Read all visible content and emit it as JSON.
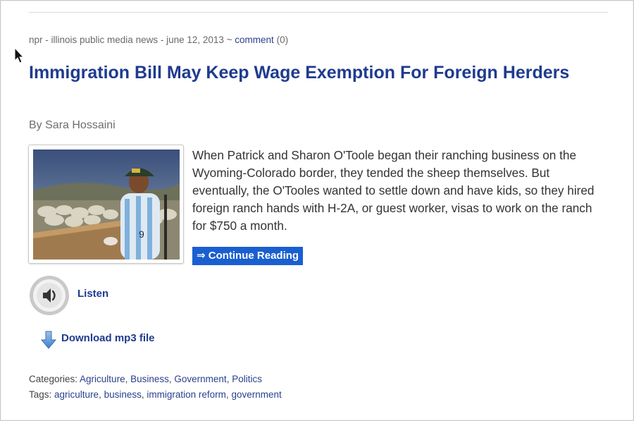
{
  "meta": {
    "source": "npr - illinois public media news - june 12, 2013 ~ ",
    "comment_label": "comment",
    "comment_count": "(0)"
  },
  "article": {
    "title": "Immigration Bill May Keep Wage Exemption For Foreign Herders",
    "byline": "By Sara Hossaini",
    "excerpt": "When Patrick and Sharon O'Toole began their ranching business on the Wyoming-Colorado border, they tended the sheep themselves. But eventually, the O'Tooles wanted to settle down and have kids, so they hired foreign ranch hands with H-2A, or guest worker, visas to work on the ranch for $750 a month.",
    "continue_label": "⇒ Continue Reading"
  },
  "audio": {
    "listen_label": "Listen",
    "download_label": "Download mp3 file"
  },
  "categories": {
    "label": "Categories: ",
    "items": [
      "Agriculture",
      "Business",
      "Government",
      "Politics"
    ]
  },
  "tags": {
    "label": "Tags: ",
    "items": [
      "agriculture",
      "business",
      "immigration reform",
      "government"
    ]
  },
  "colors": {
    "link": "#1f3b8f",
    "button_bg": "#1a5fd0"
  },
  "icons": {
    "speaker": "speaker-icon",
    "download": "download-arrow-icon",
    "cursor": "mouse-pointer-icon"
  }
}
